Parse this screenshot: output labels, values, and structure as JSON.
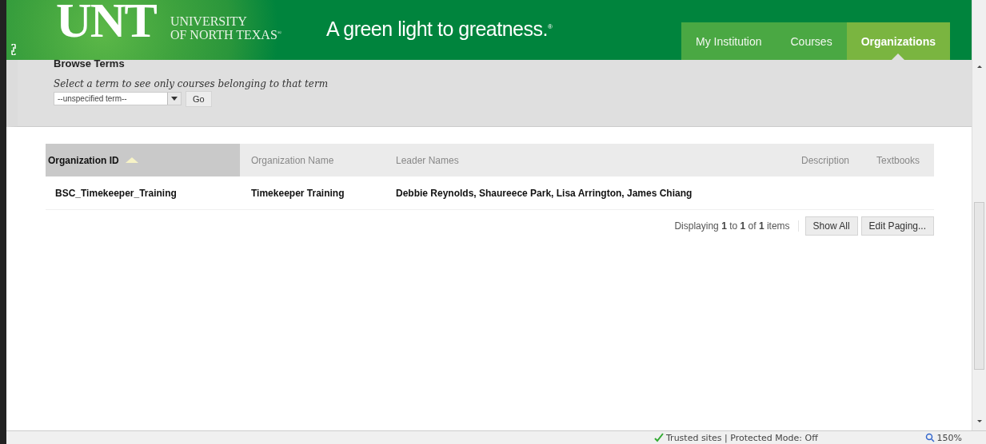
{
  "header": {
    "logo": "UNT",
    "university": [
      "UNIVERSITY",
      "OF NORTH TEXAS"
    ],
    "registered": "®",
    "tagline": "A green light to greatness.",
    "tagline_mark": "®"
  },
  "tabs": [
    {
      "label": "My Institution",
      "selected": false
    },
    {
      "label": "Courses",
      "selected": false
    },
    {
      "label": "Organizations",
      "selected": true
    }
  ],
  "browse_terms": {
    "title": "Browse Terms",
    "instructions": "Select a term to see only courses belonging to that term",
    "term_select": "--unspecified term--",
    "go_button": "Go"
  },
  "table": {
    "columns": [
      {
        "label": "Organization ID",
        "sorted": true
      },
      {
        "label": "Organization Name",
        "sorted": false
      },
      {
        "label": "Leader Names",
        "sorted": false
      },
      {
        "label": "Description",
        "sorted": false
      },
      {
        "label": "Textbooks",
        "sorted": false
      }
    ],
    "rows": [
      [
        "BSC_Timekeeper_Training",
        "Timekeeper Training",
        "Debbie Reynolds, Shaureece Park, Lisa Arrington, James Chiang"
      ]
    ]
  },
  "paging": {
    "summary": "Displaying **1** to **1** of **1** items",
    "buttons": [
      "Show All",
      "Edit Paging..."
    ]
  },
  "status_bar": {
    "security": "Trusted sites | Protected Mode: Off",
    "zoom": "150%"
  }
}
